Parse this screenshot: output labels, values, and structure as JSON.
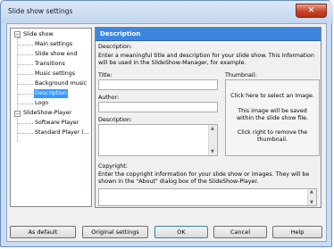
{
  "window": {
    "title": "Slide show settings",
    "close_glyph": "✕"
  },
  "tree": {
    "items": [
      {
        "label": "Slide show"
      },
      {
        "label": "Main settings"
      },
      {
        "label": "Slide show end"
      },
      {
        "label": "Transitions"
      },
      {
        "label": "Music settings"
      },
      {
        "label": "Background music"
      },
      {
        "label": "Description",
        "selected": true
      },
      {
        "label": "Logo"
      },
      {
        "label": "SlideShow-Player"
      },
      {
        "label": "Software Player"
      },
      {
        "label": "Standard Player (..."
      }
    ],
    "collapse_glyph": "−"
  },
  "panel": {
    "header": "Description",
    "description_section_label": "Description:",
    "description_help": "Enter a meaningful title and description for your slide show. This information will be used in the SlideShow-Manager, for example.",
    "title_label": "Title:",
    "title_value": "",
    "author_label": "Author:",
    "author_value": "",
    "description_label": "Description:",
    "description_value": "",
    "thumbnail_label": "Thumbnail:",
    "thumbnail_text": [
      "Click here to select an image.",
      "This image will be saved within the slide show file.",
      "Click right to remove the thumbnail."
    ],
    "copyright_label": "Copyright:",
    "copyright_help": "Enter the copyright information for your slide show or images. They will be shown in the \"About\" dialog box of the SlideShow-Player.",
    "copyright_value": "",
    "scroll_up": "▲",
    "scroll_down": "▼"
  },
  "buttons": {
    "as_default": "As default",
    "original_settings": "Original settings",
    "ok": "OK",
    "cancel": "Cancel",
    "help": "Help"
  },
  "colors": {
    "accent": "#3d86e0",
    "selection": "#3399ff",
    "close": "#c8432a"
  }
}
